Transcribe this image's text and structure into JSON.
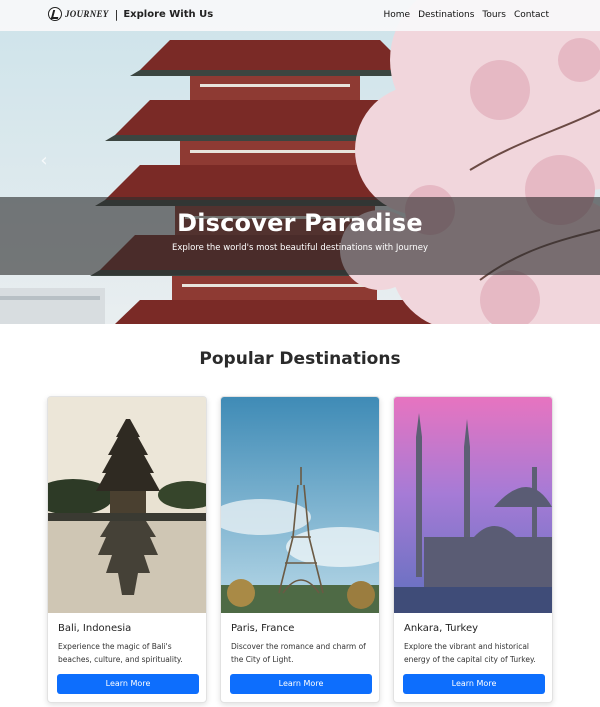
{
  "nav": {
    "logo_text": "JOURNEY",
    "separator": "|",
    "tagline": "Explore With Us",
    "links": [
      "Home",
      "Destinations",
      "Tours",
      "Contact"
    ]
  },
  "hero": {
    "title": "Discover Paradise",
    "subtitle": "Explore the world's most beautiful destinations with Journey",
    "prev_glyph": "‹"
  },
  "destinations": {
    "heading": "Popular Destinations",
    "cards": [
      {
        "title": "Bali, Indonesia",
        "text": "Experience the magic of Bali's beaches, culture, and spirituality.",
        "button": "Learn More"
      },
      {
        "title": "Paris, France",
        "text": "Discover the romance and charm of the City of Light.",
        "button": "Learn More"
      },
      {
        "title": "Ankara, Turkey",
        "text": "Explore the vibrant and historical energy of the capital city of Turkey.",
        "button": "Learn More"
      }
    ]
  },
  "colors": {
    "accent": "#0d6efd",
    "caption_band": "#2d2d2d"
  }
}
